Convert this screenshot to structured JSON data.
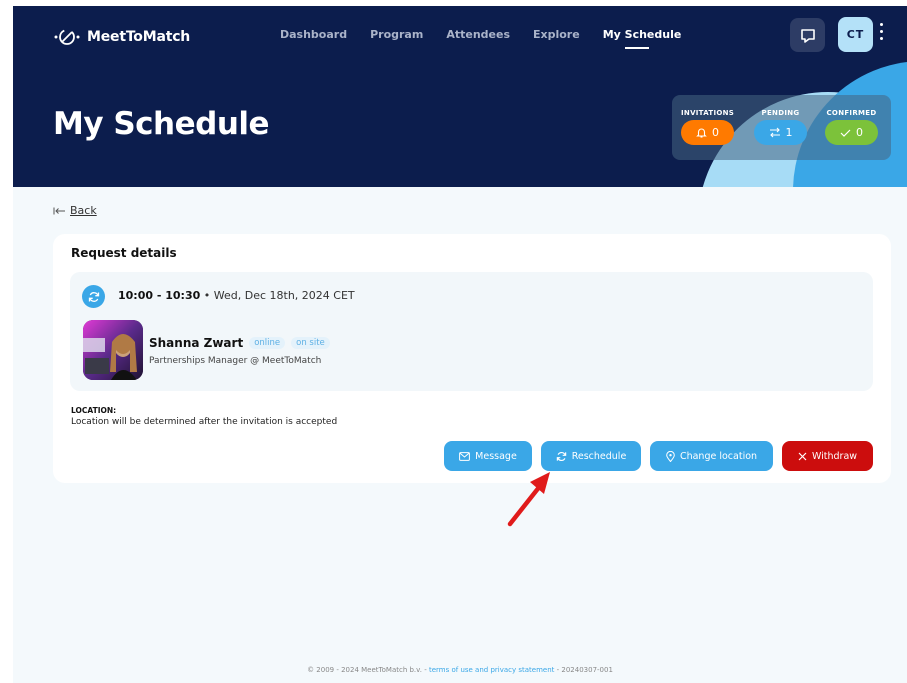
{
  "brand": {
    "name": "MeetToMatch"
  },
  "nav": {
    "items": [
      {
        "label": "Dashboard"
      },
      {
        "label": "Program"
      },
      {
        "label": "Attendees"
      },
      {
        "label": "Explore"
      },
      {
        "label": "My Schedule",
        "active": true
      }
    ]
  },
  "header": {
    "avatar_initials": "CT",
    "page_title": "My Schedule"
  },
  "stats": {
    "invitations": {
      "label": "INVITATIONS",
      "count": "0",
      "color": "#ff7a00"
    },
    "pending": {
      "label": "PENDING",
      "count": "1",
      "color": "#3aa7e7"
    },
    "confirmed": {
      "label": "CONFIRMED",
      "count": "0",
      "color": "#7cc23a"
    }
  },
  "back": {
    "label": "Back"
  },
  "request": {
    "title": "Request details",
    "time_range": "10:00 - 10:30",
    "date": "• Wed, Dec 18th, 2024 CET",
    "person": {
      "name": "Shanna Zwart",
      "tags": [
        "online",
        "on site"
      ],
      "role": "Partnerships Manager @ MeetToMatch"
    },
    "location": {
      "label": "LOCATION:",
      "text": "Location will be determined after the invitation is accepted"
    },
    "actions": {
      "message": "Message",
      "reschedule": "Reschedule",
      "change_location": "Change location",
      "withdraw": "Withdraw"
    }
  },
  "footer": {
    "copyright": "© 2009 - 2024 MeetToMatch b.v. -",
    "terms_link": "terms of use and privacy statement",
    "version": "- 20240307-001"
  },
  "colors": {
    "navy": "#0c1d4d",
    "accent_blue": "#3aa7e7",
    "danger_red": "#cc0d0d",
    "annotation_red": "#e01b1b"
  }
}
